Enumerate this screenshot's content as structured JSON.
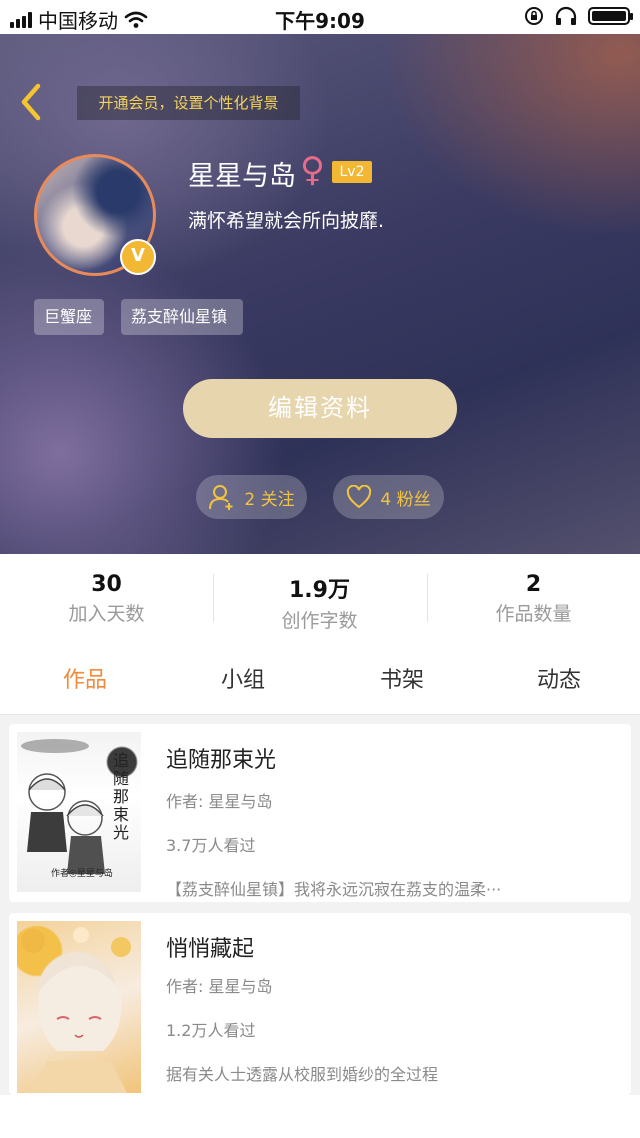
{
  "status_bar": {
    "carrier": "中国移动",
    "time": "下午9:09"
  },
  "header": {
    "banner_text": "开通会员，设置个性化背景"
  },
  "profile": {
    "name": "星星与岛",
    "gender_symbol": "♀",
    "level": "Lv2",
    "vip_badge": "V",
    "motto": "满怀希望就会所向披靡.",
    "tags": [
      "巨蟹座",
      "荔支醉仙星镇"
    ],
    "edit_label": "编辑资料",
    "following_label": "2 关注",
    "fans_label": "4 粉丝"
  },
  "stats": [
    {
      "value": "30",
      "label": "加入天数"
    },
    {
      "value": "1.9万",
      "label": "创作字数"
    },
    {
      "value": "2",
      "label": "作品数量"
    }
  ],
  "tabs": [
    {
      "label": "作品",
      "active": true
    },
    {
      "label": "小组",
      "active": false
    },
    {
      "label": "书架",
      "active": false
    },
    {
      "label": "动态",
      "active": false
    }
  ],
  "works": [
    {
      "title": "追随那束光",
      "author": "作者: 星星与岛",
      "views": "3.7万人看过",
      "desc": "【荔支醉仙星镇】我将永远沉寂在荔支的温柔···",
      "cover_text": "追随那束光",
      "cover_caption": "作者◎星星与岛"
    },
    {
      "title": "悄悄藏起",
      "author": "作者: 星星与岛",
      "views": "1.2万人看过",
      "desc": "据有关人士透露从校服到婚纱的全过程"
    }
  ],
  "colors": {
    "accent": "#f08a3c",
    "gold": "#f2b733",
    "edit_button": "#e6d5ad"
  },
  "icons": [
    "wifi-icon",
    "lock-rotation-icon",
    "headphones-icon",
    "battery-icon",
    "back-icon",
    "add-user-icon",
    "heart-icon"
  ]
}
